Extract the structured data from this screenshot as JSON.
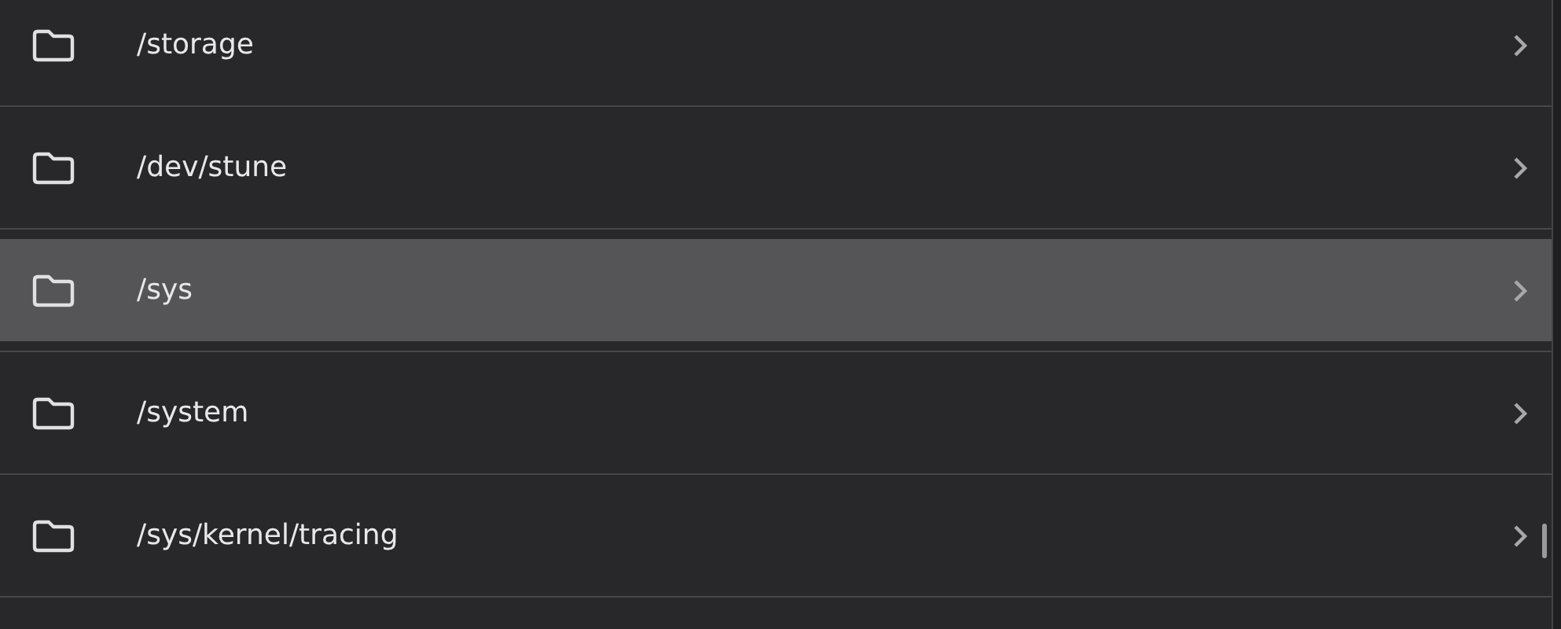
{
  "items": [
    {
      "path": "/storage",
      "selected": false
    },
    {
      "path": "/dev/stune",
      "selected": false
    },
    {
      "path": "/sys",
      "selected": true
    },
    {
      "path": "/system",
      "selected": false
    },
    {
      "path": "/sys/kernel/tracing",
      "selected": false
    }
  ]
}
